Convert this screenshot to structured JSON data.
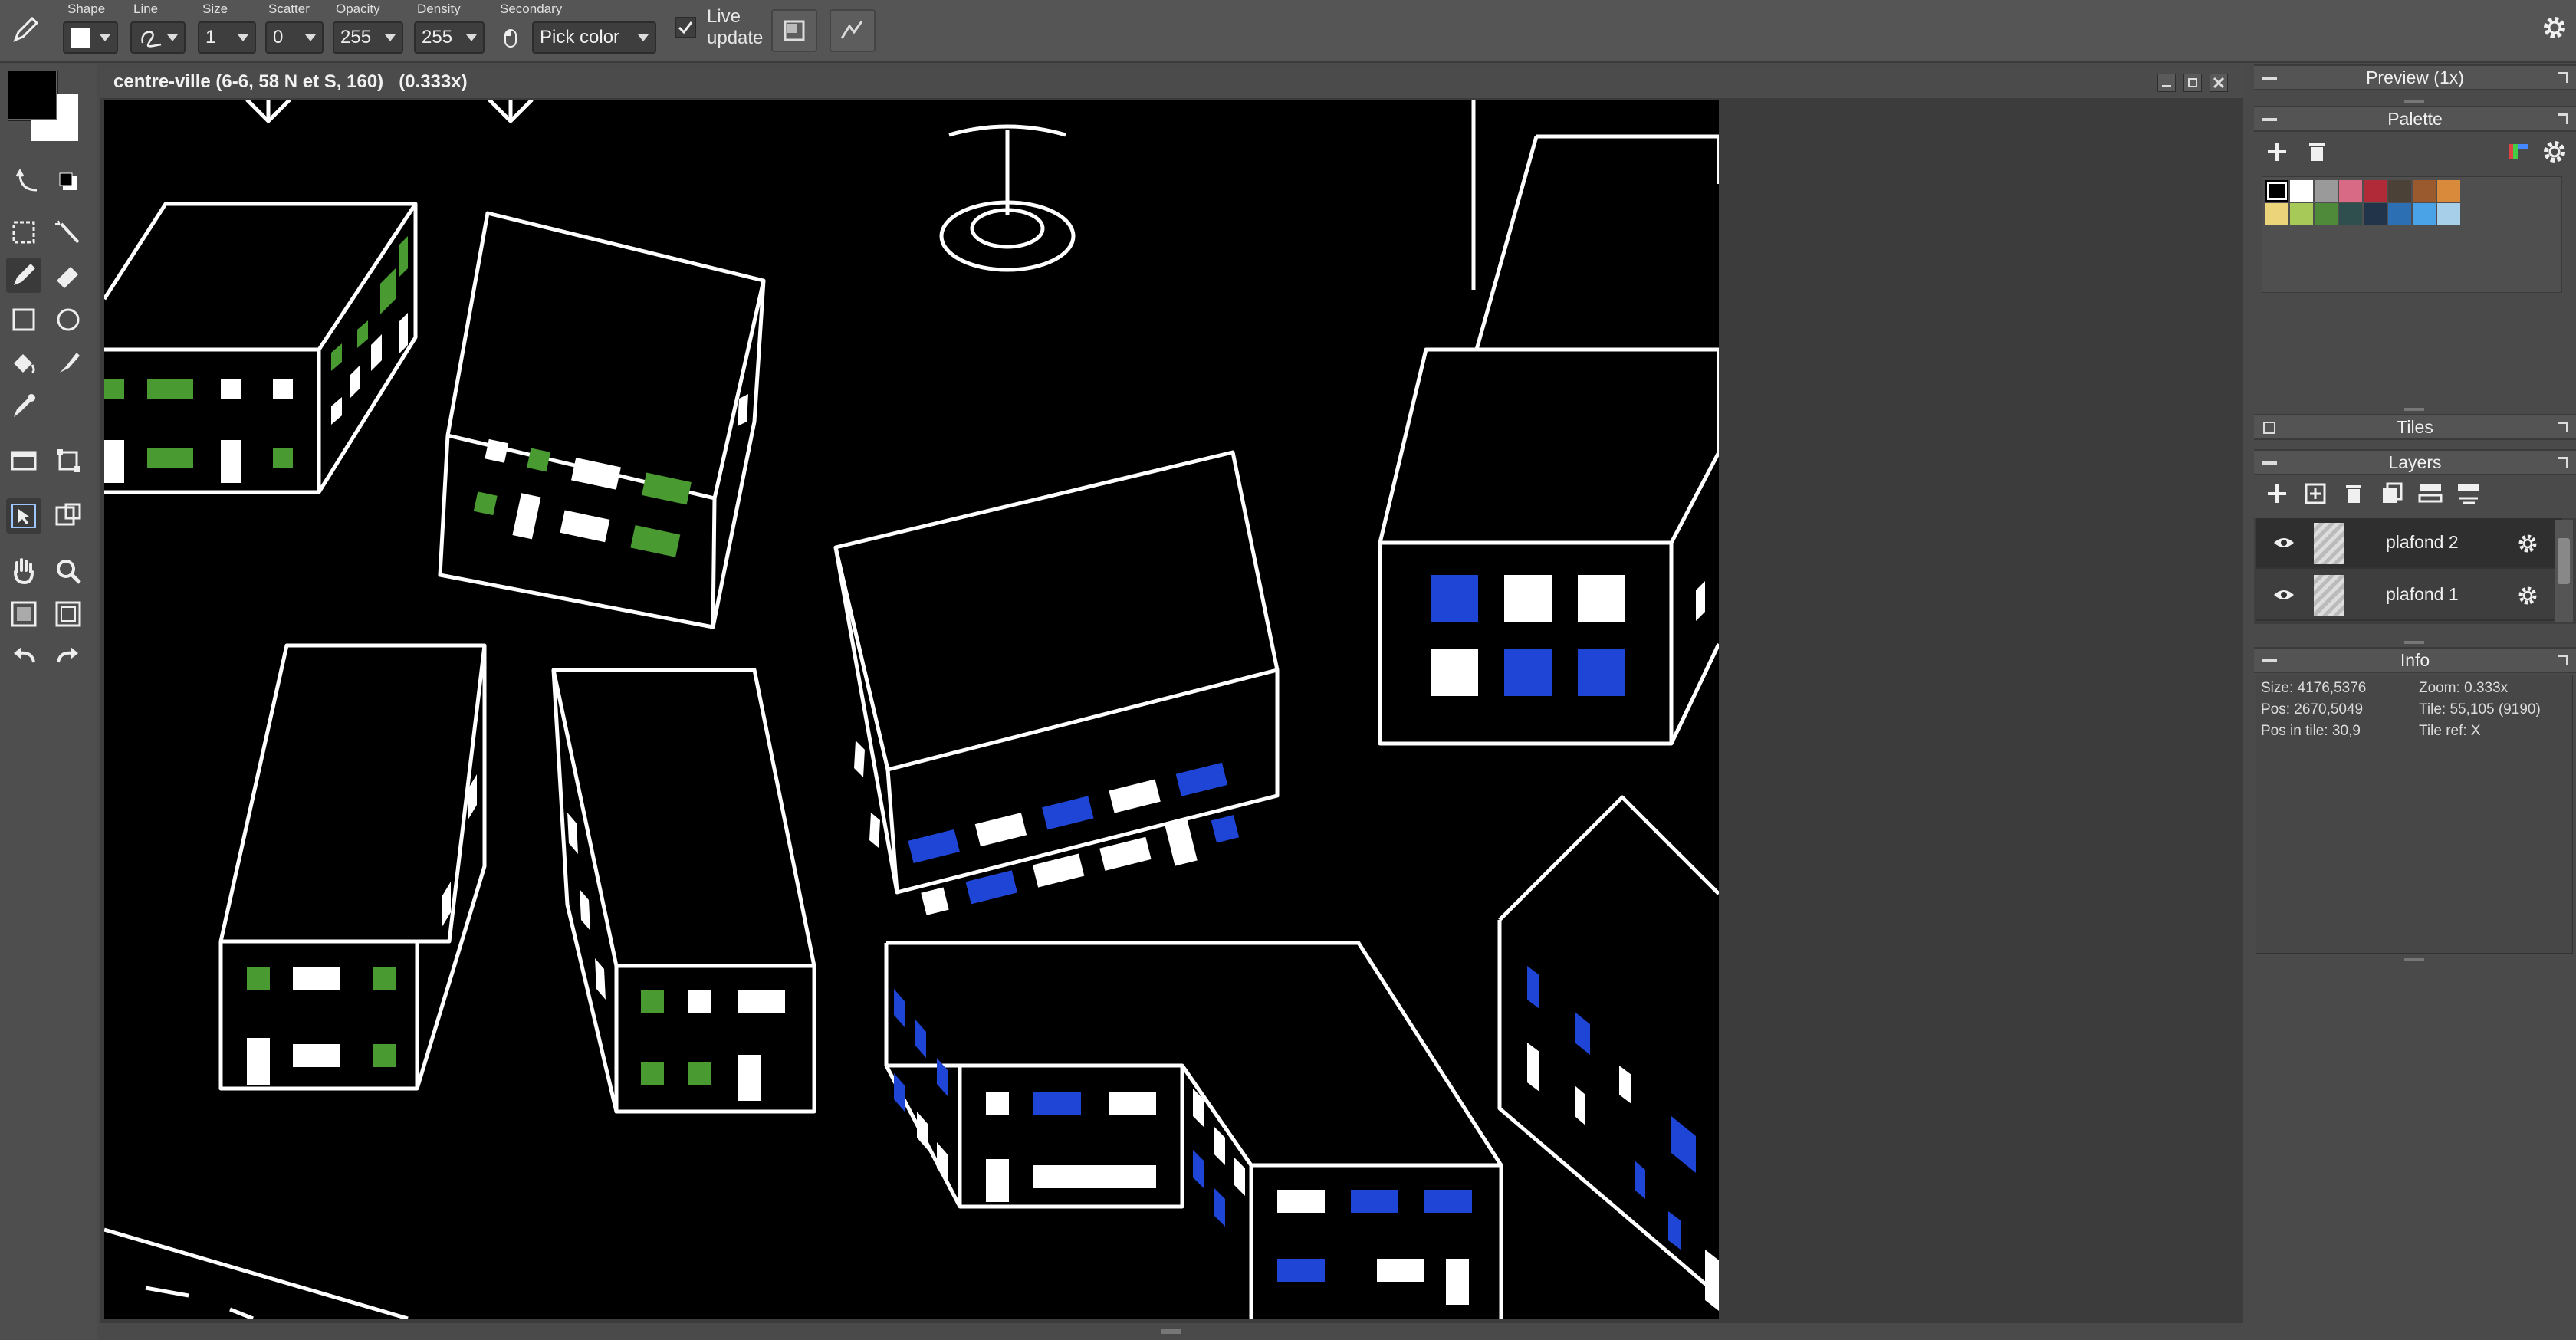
{
  "toolbar": {
    "shape_label": "Shape",
    "line_label": "Line",
    "size_label": "Size",
    "size_value": "1",
    "scatter_label": "Scatter",
    "scatter_value": "0",
    "opacity_label": "Opacity",
    "opacity_value": "255",
    "density_label": "Density",
    "density_value": "255",
    "secondary_label": "Secondary",
    "secondary_value": "Pick color",
    "live_update_line1": "Live",
    "live_update_line2": "update",
    "live_update_checked": true
  },
  "canvas": {
    "title": "centre-ville (6-6, 58 N et S, 160)",
    "zoom_text": "(0.333x)"
  },
  "panels": {
    "preview_title": "Preview (1x)",
    "palette_title": "Palette",
    "tiles_title": "Tiles",
    "layers_title": "Layers",
    "info_title": "Info"
  },
  "palette": {
    "colors": [
      "#000000",
      "#ffffff",
      "#9a9a9a",
      "#d96a86",
      "#b02a37",
      "#4b4137",
      "#9b5a2d",
      "#d98a3a",
      "#ecd47a",
      "#a7c957",
      "#4f8a3a",
      "#2f4f4f",
      "#22344a",
      "#2d6fb3",
      "#49a3e6",
      "#a8cfea"
    ],
    "selected_index": 0
  },
  "layers": [
    {
      "name": "plafond 2",
      "visible": true
    },
    {
      "name": "plafond 1",
      "visible": true
    }
  ],
  "info": {
    "size": "Size: 4176,5376",
    "zoom": "Zoom: 0.333x",
    "pos": "Pos: 2670,5049",
    "tile": "Tile: 55,105 (9190)",
    "pos_in_tile": "Pos in tile: 30,9",
    "tile_ref": "Tile ref: X"
  },
  "colors": {
    "fg": "#000000",
    "bg": "#ffffff",
    "window_green": "#4a9a32",
    "window_blue": "#1f45d6"
  }
}
